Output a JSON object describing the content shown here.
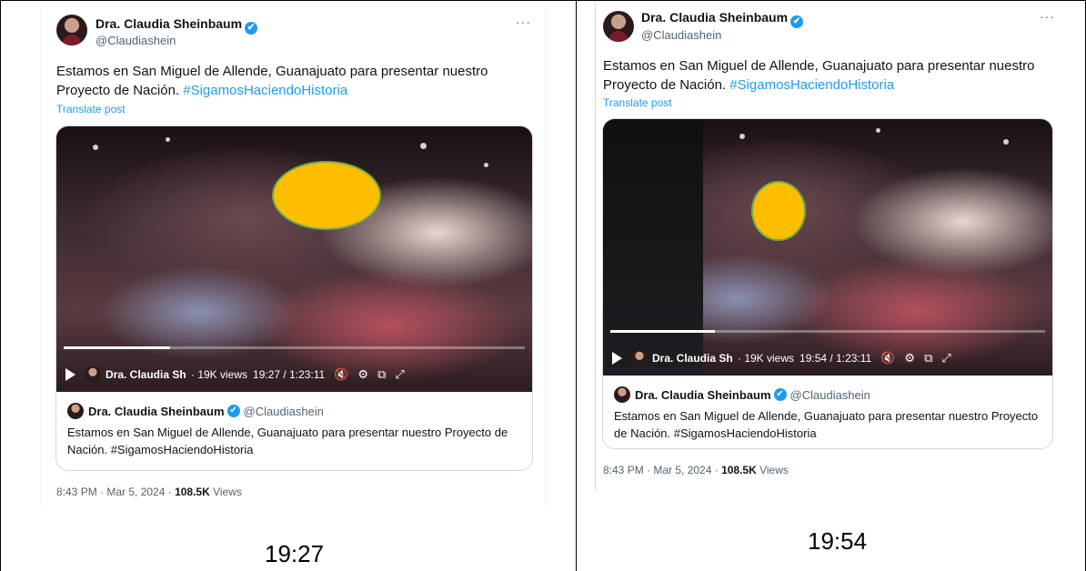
{
  "left": {
    "author": {
      "name": "Dra. Claudia Sheinbaum",
      "handle": "@Claudiashein",
      "verified_icon": "✔"
    },
    "more_label": "···",
    "text": "Estamos en San Miguel de Allende, Guanajuato para presentar nuestro Proyecto de Nación.",
    "hashtag": "#SigamosHaciendoHistoria",
    "translate": "Translate post",
    "video": {
      "channel_name": "Dra. Claudia Sheinb",
      "views": "· 19K views",
      "time": "19:27 / 1:23:11",
      "progress": 0.23
    },
    "quote": {
      "name": "Dra. Claudia Sheinbaum",
      "handle": "@Claudiashein",
      "text": "Estamos en San Miguel de Allende, Guanajuato para presentar nuestro Proyecto de Nación. #SigamosHaciendoHistoria"
    },
    "meta_prefix": "8:43 PM · Mar 5, 2024 · ",
    "meta_views": "108.5K",
    "meta_suffix": " Views",
    "caption": "19:27"
  },
  "right": {
    "author": {
      "name": "Dra. Claudia Sheinbaum",
      "handle": "@Claudiashein",
      "verified_icon": "✔"
    },
    "more_label": "···",
    "text": "Estamos en San Miguel de Allende, Guanajuato para presentar nuestro Proyecto de Nación.",
    "hashtag": "#SigamosHaciendoHistoria",
    "translate": "Translate post",
    "video": {
      "channel_name": "Dra. Claudia Sheinb",
      "views": "· 19K views",
      "time": "19:54 / 1:23:11",
      "progress": 0.24
    },
    "quote": {
      "name": "Dra. Claudia Sheinbaum",
      "handle": "@Claudiashein",
      "text": "Estamos en San Miguel de Allende, Guanajuato para presentar nuestro Proyecto de Nación. #SigamosHaciendoHistoria"
    },
    "meta_prefix": "8:43 PM · Mar 5, 2024 · ",
    "meta_views": "108.5K",
    "meta_suffix": " Views",
    "caption": "19:54"
  },
  "colors": {
    "link": "#1d9bf0",
    "redaction_fill": "#ffbf00",
    "redaction_stroke": "#70ad47"
  },
  "icons": [
    "verified-badge-icon",
    "more-icon",
    "play-icon",
    "mute-icon",
    "settings-icon",
    "pip-icon",
    "fullscreen-icon"
  ]
}
